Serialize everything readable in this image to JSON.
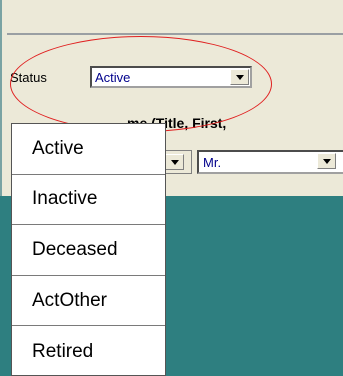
{
  "status": {
    "label": "Status",
    "value": "Active"
  },
  "table_header": {
    "name_label": "me (Title, First,"
  },
  "title_field": {
    "value": "Mr."
  },
  "dropdown": {
    "options": [
      "Active",
      "Inactive",
      "Deceased",
      "ActOther",
      "Retired"
    ]
  },
  "colors": {
    "desktop": "#2e7f80",
    "window": "#ece9d8",
    "highlight_ellipse": "#e02020",
    "field_text": "#00008b"
  }
}
